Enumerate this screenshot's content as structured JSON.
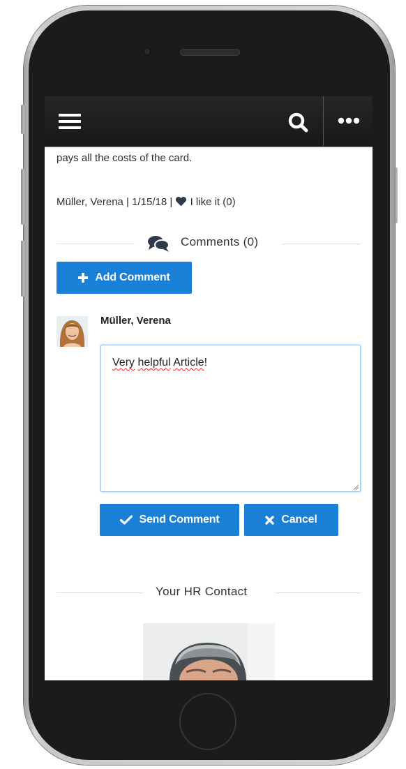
{
  "navbar": {
    "menu_icon": "hamburger-menu-icon",
    "search_icon": "search-icon",
    "more_icon": "more-horizontal-icon"
  },
  "article": {
    "body_tail": "pays all the costs of the card.",
    "meta": "Müller, Verena | 1/15/18 | ",
    "like_label": " I like it (0)",
    "like_icon": "heart-icon"
  },
  "comments": {
    "heading": "Comments (0)",
    "heading_icon": "comments-icon",
    "add_button_label": "Add Comment",
    "add_button_icon": "plus-icon"
  },
  "comment_form": {
    "author_name": "Müller, Verena",
    "avatar_icon": "user-avatar",
    "text_value_words": [
      "Very",
      "helpful",
      "Article"
    ],
    "text_value_suffix": "!",
    "send_button_label": "Send Comment",
    "send_button_icon": "checkmark-icon",
    "cancel_button_label": "Cancel",
    "cancel_button_icon": "close-icon"
  },
  "hr_contact": {
    "heading": "Your HR Contact",
    "photo": "hr-contact-photo"
  },
  "colors": {
    "accent": "#1a7fd6",
    "topbar": "#1e1e1e",
    "icon_dark": "#2f3b4c"
  }
}
